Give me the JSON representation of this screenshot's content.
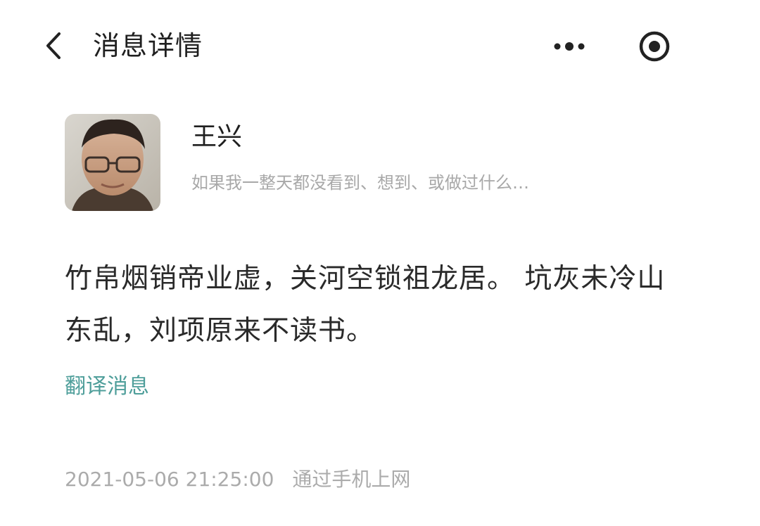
{
  "header": {
    "title": "消息详情",
    "back_icon": "chevron-left-icon",
    "more_icon": "more-dots-icon",
    "record_icon": "record-target-icon"
  },
  "sender": {
    "name": "王兴",
    "bio": "如果我一整天都没看到、想到、或做过什么…",
    "avatar_icon": "user-avatar-photo"
  },
  "message": {
    "text": "竹帛烟销帝业虚，关河空锁祖龙居。 坑灰未冷山东乱，刘项原来不读书。"
  },
  "actions": {
    "translate_label": "翻译消息"
  },
  "meta": {
    "timestamp": "2021-05-06 21:25:00",
    "source": "通过手机上网"
  },
  "colors": {
    "accent_link": "#4e9e9a",
    "muted_text": "#ababab",
    "primary_text": "#1f1f1f"
  }
}
